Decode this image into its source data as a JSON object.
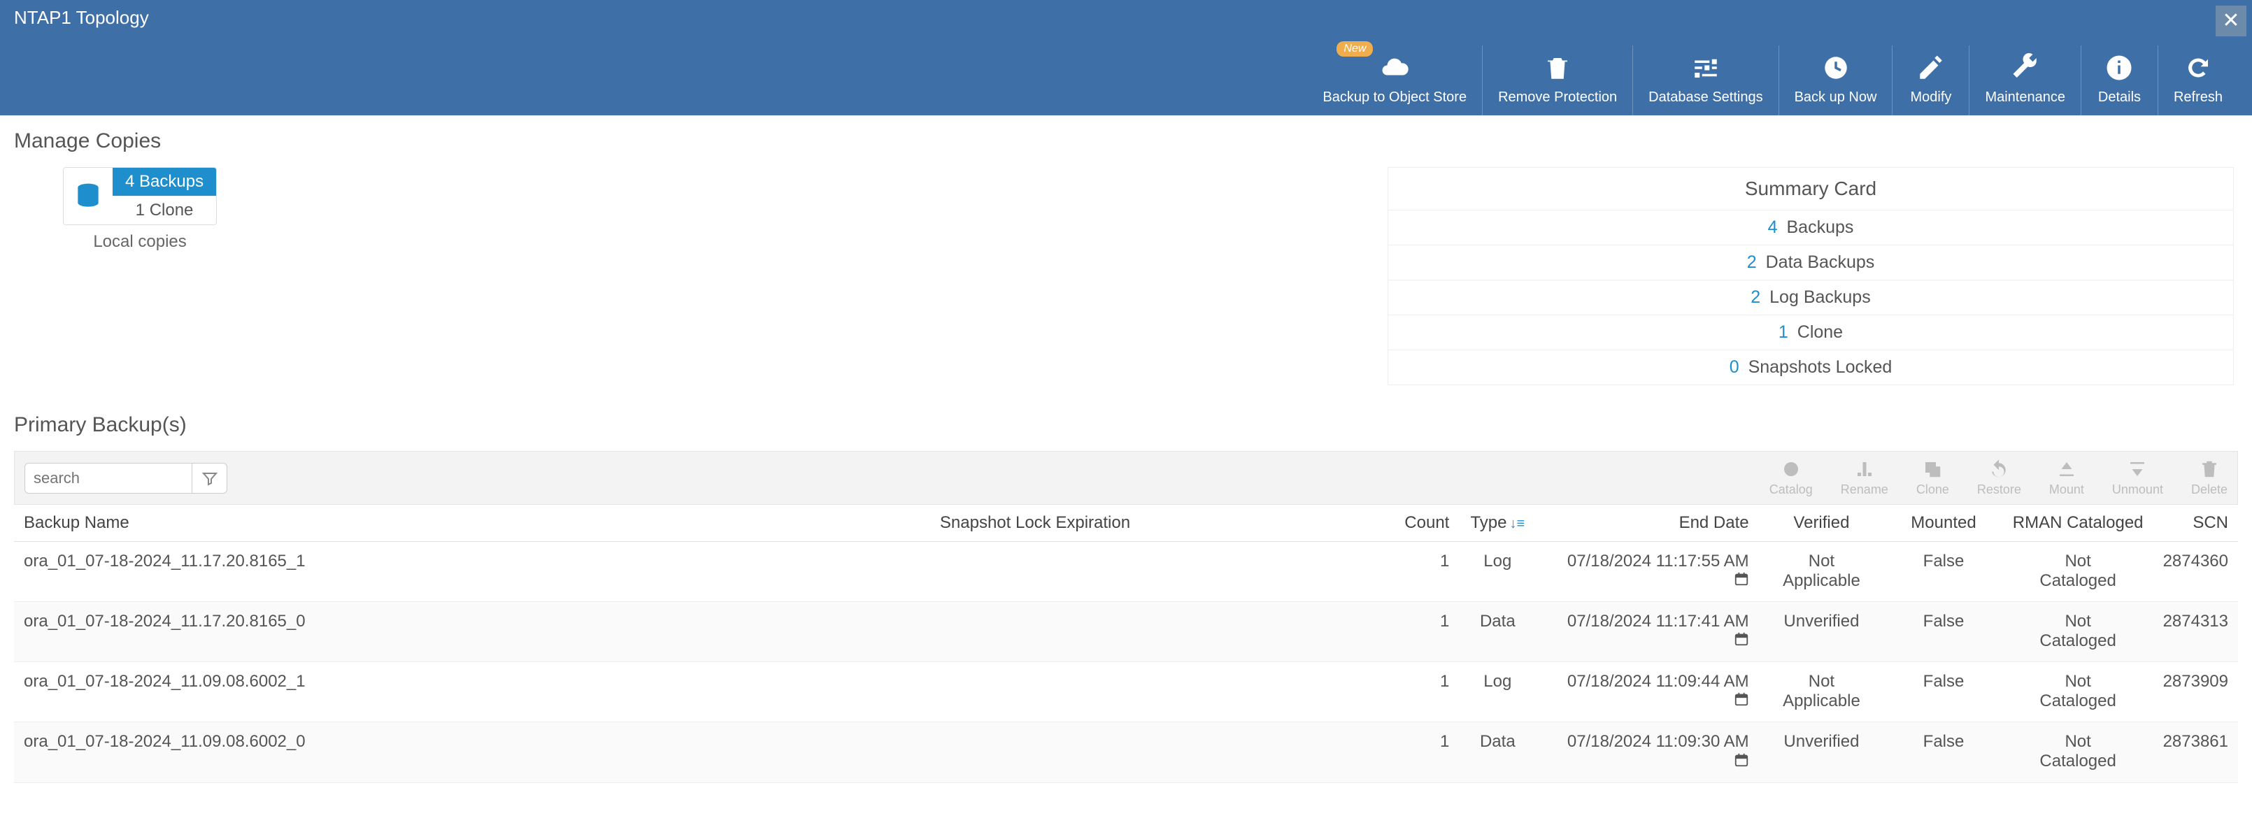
{
  "header": {
    "title": "NTAP1 Topology",
    "close": "✕"
  },
  "toolbar": {
    "backup_object_store": {
      "label": "Backup to Object Store",
      "badge": "New"
    },
    "remove_protection": {
      "label": "Remove Protection"
    },
    "database_settings": {
      "label": "Database Settings"
    },
    "back_up_now": {
      "label": "Back up Now"
    },
    "modify": {
      "label": "Modify"
    },
    "maintenance": {
      "label": "Maintenance"
    },
    "details": {
      "label": "Details"
    },
    "refresh": {
      "label": "Refresh"
    }
  },
  "manage_copies": {
    "title": "Manage Copies",
    "local": {
      "line1": "4 Backups",
      "line2": "1 Clone",
      "caption": "Local copies"
    }
  },
  "summary": {
    "title": "Summary Card",
    "backups": {
      "n": "4",
      "label": "Backups"
    },
    "data_backups": {
      "n": "2",
      "label": "Data Backups"
    },
    "log_backups": {
      "n": "2",
      "label": "Log Backups"
    },
    "clone": {
      "n": "1",
      "label": "Clone"
    },
    "snapshots_locked": {
      "n": "0",
      "label": "Snapshots Locked"
    }
  },
  "primary_backups": {
    "title": "Primary Backup(s)",
    "search_placeholder": "search",
    "row_actions": {
      "catalog": "Catalog",
      "rename": "Rename",
      "clone": "Clone",
      "restore": "Restore",
      "mount": "Mount",
      "unmount": "Unmount",
      "delete": "Delete"
    },
    "columns": {
      "name": "Backup Name",
      "snap": "Snapshot Lock Expiration",
      "count": "Count",
      "type": "Type",
      "end": "End Date",
      "ver": "Verified",
      "mounted": "Mounted",
      "rman": "RMAN Cataloged",
      "scn": "SCN"
    },
    "rows": [
      {
        "name": "ora_01_07-18-2024_11.17.20.8165_1",
        "snap": "",
        "count": "1",
        "type": "Log",
        "end": "07/18/2024 11:17:55 AM",
        "ver": "Not Applicable",
        "mounted": "False",
        "rman": "Not Cataloged",
        "scn": "2874360"
      },
      {
        "name": "ora_01_07-18-2024_11.17.20.8165_0",
        "snap": "",
        "count": "1",
        "type": "Data",
        "end": "07/18/2024 11:17:41 AM",
        "ver": "Unverified",
        "mounted": "False",
        "rman": "Not Cataloged",
        "scn": "2874313"
      },
      {
        "name": "ora_01_07-18-2024_11.09.08.6002_1",
        "snap": "",
        "count": "1",
        "type": "Log",
        "end": "07/18/2024 11:09:44 AM",
        "ver": "Not Applicable",
        "mounted": "False",
        "rman": "Not Cataloged",
        "scn": "2873909"
      },
      {
        "name": "ora_01_07-18-2024_11.09.08.6002_0",
        "snap": "",
        "count": "1",
        "type": "Data",
        "end": "07/18/2024 11:09:30 AM",
        "ver": "Unverified",
        "mounted": "False",
        "rman": "Not Cataloged",
        "scn": "2873861"
      }
    ]
  }
}
